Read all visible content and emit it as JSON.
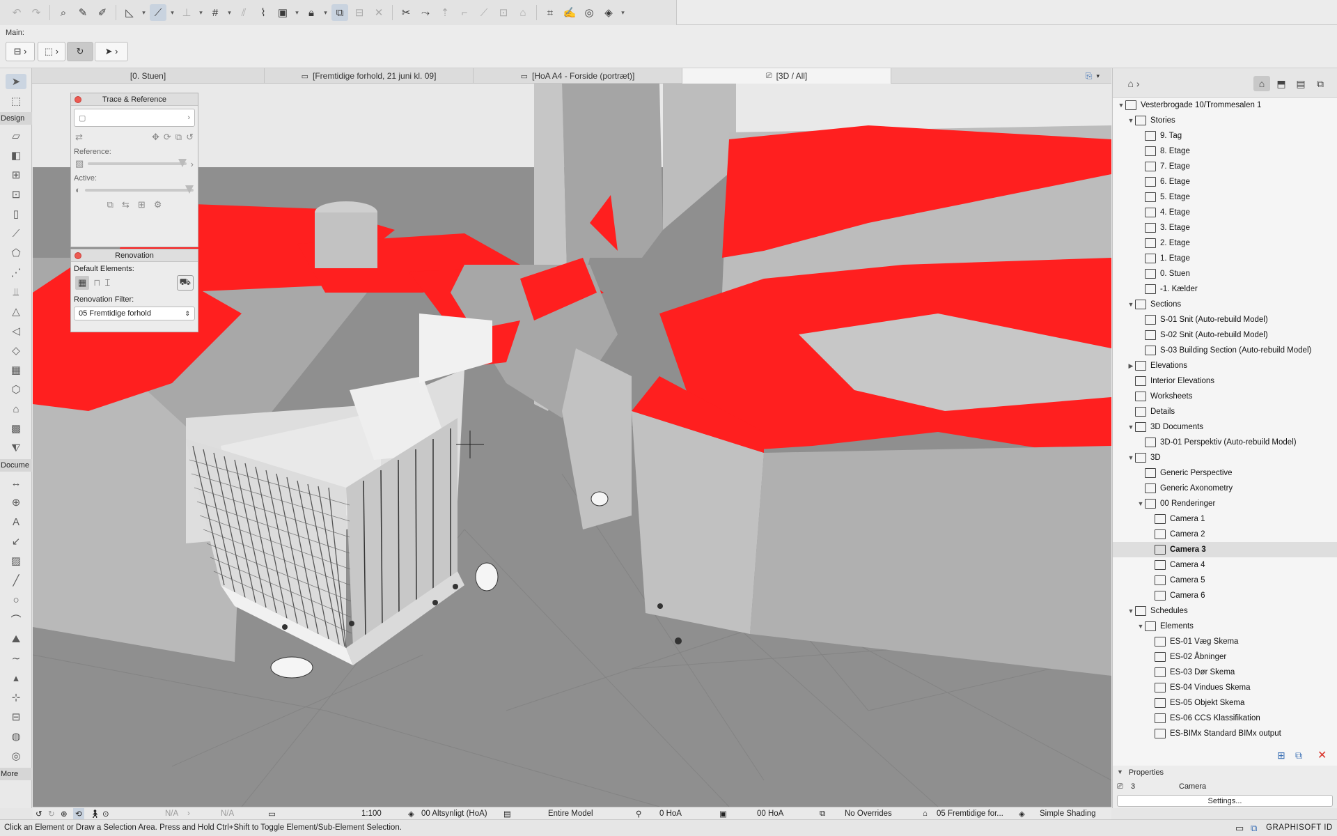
{
  "toolbar": {
    "icons": [
      "undo-icon",
      "redo-icon",
      "find-select-icon",
      "eyedropper-icon",
      "inject-icon",
      "measure-icon",
      "magic-wand-icon",
      "gravity-icon",
      "grid-snap-icon",
      "guide-line-icon",
      "suspend-groups-icon",
      "lock-icon",
      "trace-icon",
      "layout-icon",
      "explode-icon",
      "split-icon",
      "adjust-icon",
      "offset-icon",
      "fillet-icon",
      "trim-icon",
      "render-icon",
      "3d-style-icon",
      "mark-up-icon",
      "teamwork-icon",
      "send-icon"
    ]
  },
  "infobox": {
    "main_label": "Main:"
  },
  "tabs": [
    {
      "label": "[0. Stuen]",
      "icon": "floor-plan-icon"
    },
    {
      "label": "[Fremtidige forhold, 21 juni kl. 09]",
      "icon": "layout-sheet-icon"
    },
    {
      "label": "[HoA A4 - Forside (portræt)]",
      "icon": "layout-sheet-icon"
    },
    {
      "label": "[3D / All]",
      "icon": "camera-icon"
    }
  ],
  "toolbox": {
    "design_header": "Design",
    "document_header": "Docume",
    "more_header": "More"
  },
  "trace_palette": {
    "title": "Trace & Reference",
    "reference_label": "Reference:",
    "active_label": "Active:"
  },
  "renovation_palette": {
    "title": "Renovation",
    "default_elements_label": "Default Elements:",
    "filter_label": "Renovation Filter:",
    "filter_value": "05 Fremtidige forhold"
  },
  "navigator": {
    "tree": [
      {
        "label": "Vesterbrogade 10/Trommesalen 1",
        "level": 0,
        "twisty": "open",
        "icon": "project-icon"
      },
      {
        "label": "Stories",
        "level": 1,
        "twisty": "open",
        "icon": "stories-icon"
      },
      {
        "label": "9.  Tag",
        "level": 2,
        "twisty": "",
        "icon": "story-icon"
      },
      {
        "label": "8. Etage",
        "level": 2,
        "twisty": "",
        "icon": "story-icon"
      },
      {
        "label": "7. Etage",
        "level": 2,
        "twisty": "",
        "icon": "story-icon"
      },
      {
        "label": "6. Etage",
        "level": 2,
        "twisty": "",
        "icon": "story-icon"
      },
      {
        "label": "5. Etage",
        "level": 2,
        "twisty": "",
        "icon": "story-icon"
      },
      {
        "label": "4. Etage",
        "level": 2,
        "twisty": "",
        "icon": "story-icon"
      },
      {
        "label": "3. Etage",
        "level": 2,
        "twisty": "",
        "icon": "story-icon"
      },
      {
        "label": "2. Etage",
        "level": 2,
        "twisty": "",
        "icon": "story-icon"
      },
      {
        "label": "1. Etage",
        "level": 2,
        "twisty": "",
        "icon": "story-icon"
      },
      {
        "label": "0. Stuen",
        "level": 2,
        "twisty": "",
        "icon": "story-icon"
      },
      {
        "label": "-1. Kælder",
        "level": 2,
        "twisty": "",
        "icon": "story-icon"
      },
      {
        "label": "Sections",
        "level": 1,
        "twisty": "open",
        "icon": "sections-icon"
      },
      {
        "label": "S-01 Snit (Auto-rebuild Model)",
        "level": 2,
        "twisty": "",
        "icon": "section-icon"
      },
      {
        "label": "S-02 Snit (Auto-rebuild Model)",
        "level": 2,
        "twisty": "",
        "icon": "section-icon"
      },
      {
        "label": "S-03 Building Section (Auto-rebuild Model)",
        "level": 2,
        "twisty": "",
        "icon": "section-icon"
      },
      {
        "label": "Elevations",
        "level": 1,
        "twisty": "closed",
        "icon": "elevations-icon"
      },
      {
        "label": "Interior Elevations",
        "level": 1,
        "twisty": "",
        "icon": "interior-elevations-icon"
      },
      {
        "label": "Worksheets",
        "level": 1,
        "twisty": "",
        "icon": "worksheets-icon"
      },
      {
        "label": "Details",
        "level": 1,
        "twisty": "",
        "icon": "details-icon"
      },
      {
        "label": "3D Documents",
        "level": 1,
        "twisty": "open",
        "icon": "3d-documents-icon"
      },
      {
        "label": "3D-01 Perspektiv (Auto-rebuild Model)",
        "level": 2,
        "twisty": "",
        "icon": "3d-document-icon"
      },
      {
        "label": "3D",
        "level": 1,
        "twisty": "open",
        "icon": "3d-folder-icon"
      },
      {
        "label": "Generic Perspective",
        "level": 2,
        "twisty": "",
        "icon": "perspective-icon"
      },
      {
        "label": "Generic Axonometry",
        "level": 2,
        "twisty": "",
        "icon": "axonometry-icon"
      },
      {
        "label": "00 Renderinger",
        "level": 2,
        "twisty": "open",
        "icon": "camera-set-icon"
      },
      {
        "label": "Camera 1",
        "level": 3,
        "twisty": "",
        "icon": "camera-icon"
      },
      {
        "label": "Camera 2",
        "level": 3,
        "twisty": "",
        "icon": "camera-icon"
      },
      {
        "label": "Camera 3",
        "level": 3,
        "twisty": "",
        "icon": "camera-icon",
        "selected": true
      },
      {
        "label": "Camera 4",
        "level": 3,
        "twisty": "",
        "icon": "camera-icon"
      },
      {
        "label": "Camera 5",
        "level": 3,
        "twisty": "",
        "icon": "camera-icon"
      },
      {
        "label": "Camera 6",
        "level": 3,
        "twisty": "",
        "icon": "camera-icon"
      },
      {
        "label": "Schedules",
        "level": 1,
        "twisty": "open",
        "icon": "schedules-icon"
      },
      {
        "label": "Elements",
        "level": 2,
        "twisty": "open",
        "icon": "elements-icon"
      },
      {
        "label": "ES-01 Væg Skema",
        "level": 3,
        "twisty": "",
        "icon": "schedule-icon"
      },
      {
        "label": "ES-02 Åbninger",
        "level": 3,
        "twisty": "",
        "icon": "schedule-icon"
      },
      {
        "label": "ES-03 Dør Skema",
        "level": 3,
        "twisty": "",
        "icon": "schedule-icon"
      },
      {
        "label": "ES-04 Vindues Skema",
        "level": 3,
        "twisty": "",
        "icon": "schedule-icon"
      },
      {
        "label": "ES-05 Objekt Skema",
        "level": 3,
        "twisty": "",
        "icon": "schedule-icon"
      },
      {
        "label": "ES-06 CCS Klassifikation",
        "level": 3,
        "twisty": "",
        "icon": "schedule-icon"
      },
      {
        "label": "ES-BIMx Standard BIMx output",
        "level": 3,
        "twisty": "",
        "icon": "schedule-icon"
      }
    ]
  },
  "properties": {
    "title": "Properties",
    "id_value": "3",
    "type_value": "Camera",
    "settings_label": "Settings..."
  },
  "navbar": {
    "na_1": "N/A",
    "na_2": "N/A",
    "scale": "1:100",
    "layer_combo": "00 Altsynligt (HoA)",
    "model_view": "Entire Model",
    "pen_set": "0 HoA",
    "dimension": "00 HoA",
    "overrides": "No Overrides",
    "renovation": "05 Fremtidige for...",
    "shading": "Simple Shading"
  },
  "status": {
    "message": "Click an Element or Draw a Selection Area. Press and Hold Ctrl+Shift to Toggle Element/Sub-Element Selection.",
    "brand": "GRAPHISOFT ID"
  },
  "colors": {
    "roof_red": "#ff1f1f",
    "ground": "#8f8f8f",
    "building_light": "#d8d8d8",
    "selection_blue": "#cbd5e1"
  }
}
